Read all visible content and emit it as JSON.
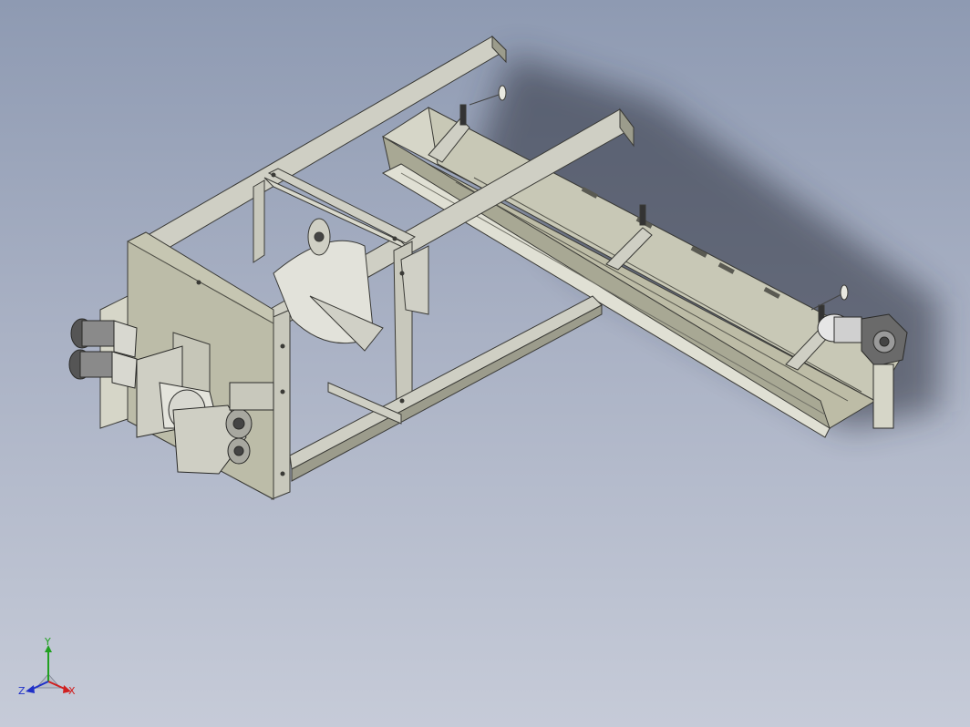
{
  "viewport": {
    "background_top": "#8e9ab2",
    "background_bottom": "#c6cbd8"
  },
  "model": {
    "frame_color": "#cfcfc4",
    "shade_color": "#9c9c8c",
    "edge_color": "#3a3a36",
    "trough_color": "#bdbca6",
    "motor_color": "#d8d8d8"
  },
  "triad": {
    "x_label": "X",
    "y_label": "Y",
    "z_label": "Z",
    "x_color": "#d02020",
    "y_color": "#20a020",
    "z_color": "#2030c8"
  }
}
